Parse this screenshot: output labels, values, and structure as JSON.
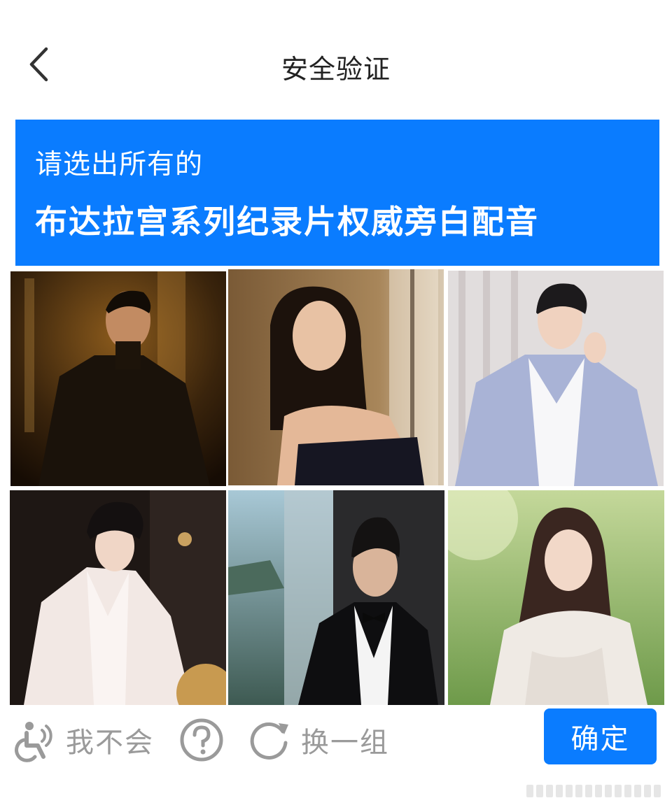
{
  "header": {
    "title": "安全验证"
  },
  "banner": {
    "instruction": "请选出所有的",
    "target": "布达拉宫系列纪录片权威旁白配音",
    "color": "#0a7cff"
  },
  "tiles": [
    {
      "name": "photo-man-dark-coat"
    },
    {
      "name": "photo-woman-strapless-dress"
    },
    {
      "name": "photo-man-blue-suit"
    },
    {
      "name": "photo-man-white-suit"
    },
    {
      "name": "photo-man-tuxedo-window"
    },
    {
      "name": "photo-woman-white-sweater"
    }
  ],
  "actions": {
    "accessibility_label": "我不会",
    "refresh_label": "换一组",
    "confirm_label": "确定"
  },
  "icons": {
    "back": "chevron-left-icon",
    "accessibility": "accessibility-audio-icon",
    "help": "question-circle-icon",
    "refresh": "refresh-icon"
  }
}
